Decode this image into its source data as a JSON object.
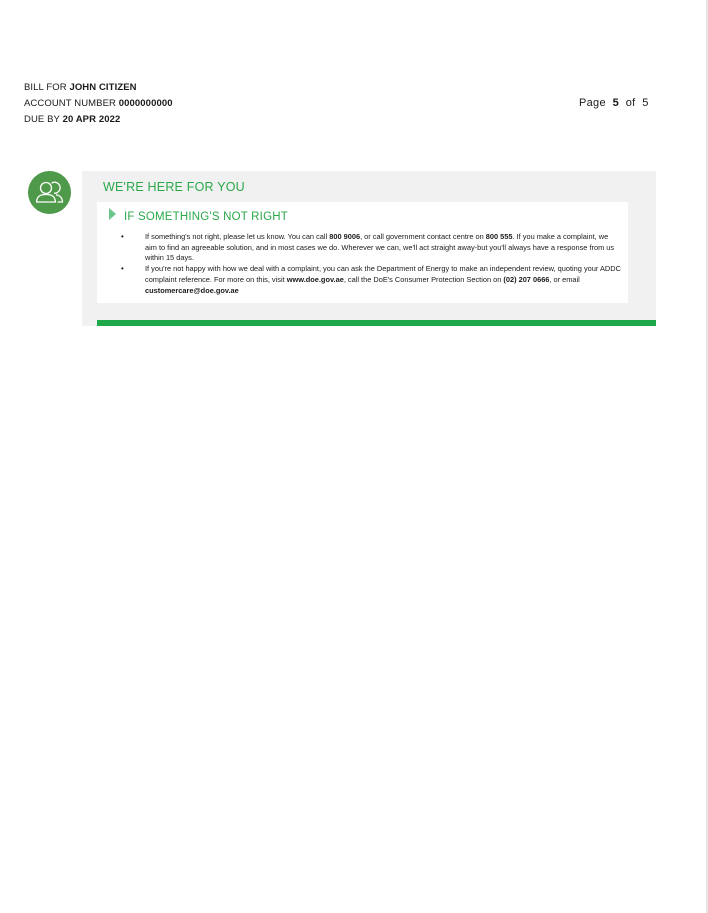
{
  "header": {
    "bill_for_label": "BILL FOR",
    "customer_name": "JOHN CITIZEN",
    "account_label": "ACCOUNT NUMBER",
    "account_number": "0000000000",
    "due_label": "DUE BY",
    "due_date": "20 APR 2022"
  },
  "pagination": {
    "page_label": "Page",
    "current": "5",
    "of_label": "of",
    "total": "5"
  },
  "section": {
    "title": "WE'RE HERE FOR YOU",
    "icon": "user-group-icon",
    "subsection_title": "IF SOMETHING'S NOT RIGHT",
    "bullet1": {
      "t1": "If something's not right, please let us know. You can call ",
      "phone": "800 9006",
      "t2": ", or call government contact centre on ",
      "gov_phone": "800 555",
      "t3": ". If you make a complaint, we aim to find an agreeable solution, and in most cases we do. Wherever we can, we'll act straight away-but you'll always have a response from us within 15 days."
    },
    "bullet2": {
      "t1": "If you're not happy with how we deal with a complaint, you can ask the Department of Energy to make an independent review, quoting your ADDC complaint reference. For more on this, visit ",
      "website": "www.doe.gov.ae",
      "t2": ", call the DoE's Consumer Protection Section on ",
      "doe_phone": "(02) 207 0666",
      "t3": ", or email ",
      "email": "customercare@doe.gov.ae"
    }
  },
  "colors": {
    "accent_green": "#2aa84a",
    "bar_green": "#1fa84a",
    "avatar_green": "#4f9a4a",
    "panel_gray": "#f1f1f1"
  }
}
